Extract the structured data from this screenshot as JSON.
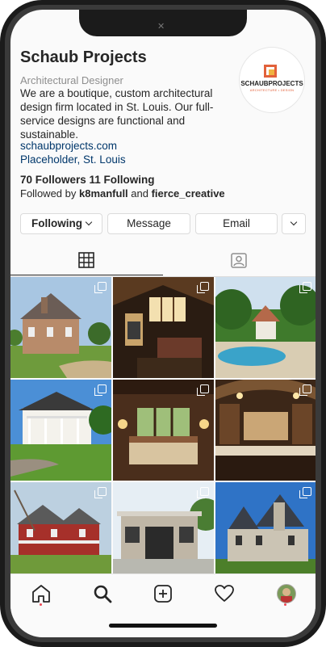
{
  "profile": {
    "name": "Schaub Projects",
    "category": "Architectural Designer",
    "bio": "We are a boutique, custom architectural design firm located in St. Louis. Our full-service designs are functional and sustainable.",
    "website": "schaubprojects.com",
    "address": "Placeholder, St. Louis",
    "stats": "70 Followers  11 Following",
    "followed_prefix": "Followed by ",
    "followed_user1": "k8manfull",
    "followed_and": " and ",
    "followed_user2": "fierce_creative",
    "logo_text": "SCHAUBPROJECTS",
    "logo_subtext": "ARCHITECTURE • DESIGN"
  },
  "buttons": {
    "following": "Following",
    "message": "Message",
    "email": "Email"
  },
  "tabs": [
    "grid-icon",
    "tagged-icon"
  ],
  "grid": [
    {
      "subject": "stone manor house exterior",
      "multi": true
    },
    {
      "subject": "great room interior with vaulted ceiling",
      "multi": true
    },
    {
      "subject": "pool with gazebo",
      "multi": true
    },
    {
      "subject": "white colonial house",
      "multi": true
    },
    {
      "subject": "bedroom interior",
      "multi": true
    },
    {
      "subject": "kitchen with stone arch",
      "multi": true
    },
    {
      "subject": "red farmhouse",
      "multi": true
    },
    {
      "subject": "modern stone house",
      "multi": true
    },
    {
      "subject": "stone chateau",
      "multi": true
    }
  ],
  "nav": [
    "home-icon",
    "search-icon",
    "add-post-icon",
    "heart-icon",
    "profile-avatar"
  ],
  "colors": {
    "accent_link": "#00376b",
    "notification_dot": "#ed4956"
  }
}
